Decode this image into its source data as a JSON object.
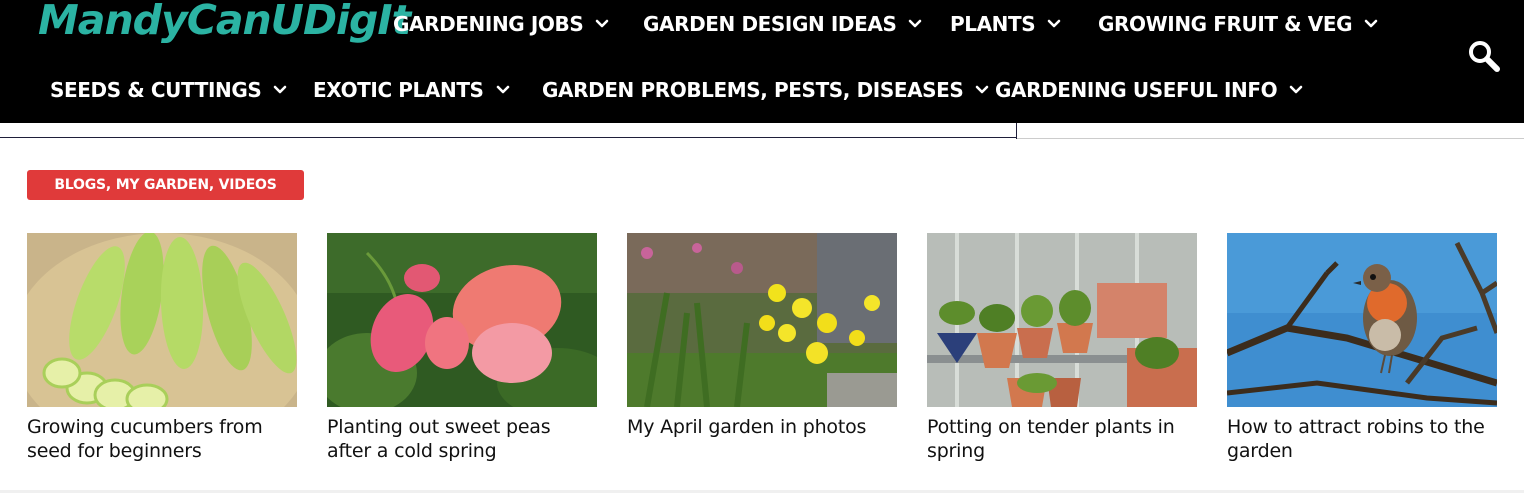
{
  "site": {
    "logo_text": "MandyCanUDigIt",
    "logo_color": "#2bb3a3"
  },
  "nav": {
    "row1": [
      {
        "label": "GARDENING JOBS"
      },
      {
        "label": "GARDEN DESIGN IDEAS"
      },
      {
        "label": "PLANTS"
      },
      {
        "label": "GROWING FRUIT & VEG"
      }
    ],
    "row2": [
      {
        "label": "SEEDS & CUTTINGS"
      },
      {
        "label": "EXOTIC PLANTS"
      },
      {
        "label": "GARDEN PROBLEMS, PESTS, DISEASES"
      },
      {
        "label": "GARDENING USEFUL INFO"
      }
    ],
    "dropdown_icon": "chevron-down-icon",
    "search_icon": "search-icon"
  },
  "category": {
    "label": "BLOGS, MY GARDEN, VIDEOS",
    "color": "#e03a3a"
  },
  "posts": [
    {
      "title": "Growing cucumbers from seed for beginners"
    },
    {
      "title": "Planting out sweet peas after a cold spring"
    },
    {
      "title": "My April garden in photos"
    },
    {
      "title": "Potting on tender plants in spring"
    },
    {
      "title": "How to attract robins to the garden"
    }
  ]
}
